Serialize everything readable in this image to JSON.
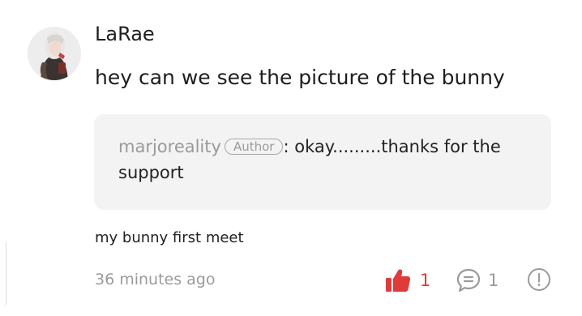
{
  "comment": {
    "username": "LaRae",
    "text": "hey can we see the picture of the bunny",
    "avatar_icon": "avatar-anime-character"
  },
  "reply": {
    "author": "marjoreality",
    "badge": "Author",
    "separator": ":",
    "text_line1": "okay.........thanks for the",
    "text_line2": "support"
  },
  "subcaption": "my bunny first meet",
  "footer": {
    "timestamp": "36 minutes ago",
    "like_count": "1",
    "comment_count": "1",
    "like_icon": "thumbs-up-icon",
    "comment_icon": "comment-bubble-icon",
    "report_icon": "report-icon"
  },
  "colors": {
    "like": "#e03a3a",
    "muted": "#9b9b9b",
    "reply_bg": "#f3f3f3"
  }
}
